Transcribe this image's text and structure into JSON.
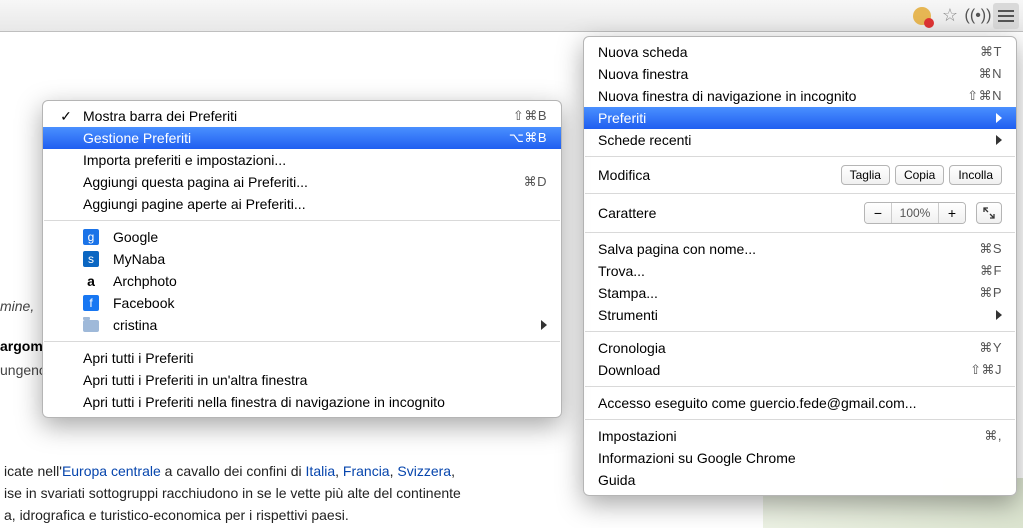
{
  "toolbar": {
    "cookie_icon": "cookie-block-icon",
    "star_icon": "star-outline-icon",
    "broadcast_icon": "broadcast-icon",
    "menu_icon": "hamburger-icon"
  },
  "mainMenu": {
    "items": [
      {
        "label": "Nuova scheda",
        "shortcut": "⌘T"
      },
      {
        "label": "Nuova finestra",
        "shortcut": "⌘N"
      },
      {
        "label": "Nuova finestra di navigazione in incognito",
        "shortcut": "⇧⌘N"
      },
      {
        "label": "Preferiti",
        "submenu": true,
        "highlighted": true
      },
      {
        "label": "Schede recenti",
        "submenu": true
      }
    ],
    "edit": {
      "label": "Modifica",
      "cut": "Taglia",
      "copy": "Copia",
      "paste": "Incolla"
    },
    "zoom": {
      "label": "Carattere",
      "minus": "−",
      "value": "100%",
      "plus": "+"
    },
    "items2": [
      {
        "label": "Salva pagina con nome...",
        "shortcut": "⌘S"
      },
      {
        "label": "Trova...",
        "shortcut": "⌘F"
      },
      {
        "label": "Stampa...",
        "shortcut": "⌘P"
      },
      {
        "label": "Strumenti",
        "submenu": true
      }
    ],
    "items3": [
      {
        "label": "Cronologia",
        "shortcut": "⌘Y"
      },
      {
        "label": "Download",
        "shortcut": "⇧⌘J"
      }
    ],
    "account": "Accesso eseguito come guercio.fede@gmail.com...",
    "items4": [
      {
        "label": "Impostazioni",
        "shortcut": "⌘,"
      },
      {
        "label": "Informazioni su Google Chrome"
      },
      {
        "label": "Guida"
      }
    ]
  },
  "subMenu": {
    "group1": [
      {
        "label": "Mostra barra dei Preferiti",
        "shortcut": "⇧⌘B",
        "checked": true
      },
      {
        "label": "Gestione Preferiti",
        "shortcut": "⌥⌘B",
        "highlighted": true
      },
      {
        "label": "Importa preferiti e impostazioni..."
      },
      {
        "label": "Aggiungi questa pagina ai Preferiti...",
        "shortcut": "⌘D"
      },
      {
        "label": "Aggiungi pagine aperte ai Preferiti..."
      }
    ],
    "bookmarks": [
      {
        "icon": "g",
        "label": "Google"
      },
      {
        "icon": "s",
        "label": "MyNaba"
      },
      {
        "icon": "a",
        "label": "Archphoto"
      },
      {
        "icon": "f",
        "label": "Facebook"
      },
      {
        "icon": "folder",
        "label": "cristina",
        "submenu": true
      }
    ],
    "group3": [
      {
        "label": "Apri tutti i Preferiti"
      },
      {
        "label": "Apri tutti i Preferiti in un'altra finestra"
      },
      {
        "label": "Apri tutti i Preferiti nella finestra di navigazione in incognito"
      }
    ]
  },
  "page": {
    "mine": "mine,",
    "argom": "argom",
    "ungen": "ungenc",
    "p1_a": "icate nell'",
    "p1_l1": "Europa centrale",
    "p1_b": " a cavallo dei confini di ",
    "p1_l2": "Italia",
    "p1_c": ", ",
    "p1_l3": "Francia",
    "p1_d": ", ",
    "p1_l4": "Svizzera",
    "p1_e": ",",
    "p2": "ise in svariati sottogruppi racchiudono in se le vette più alte del continente",
    "p3": "a, idrografica e turistico-economica per i rispettivi paesi."
  }
}
